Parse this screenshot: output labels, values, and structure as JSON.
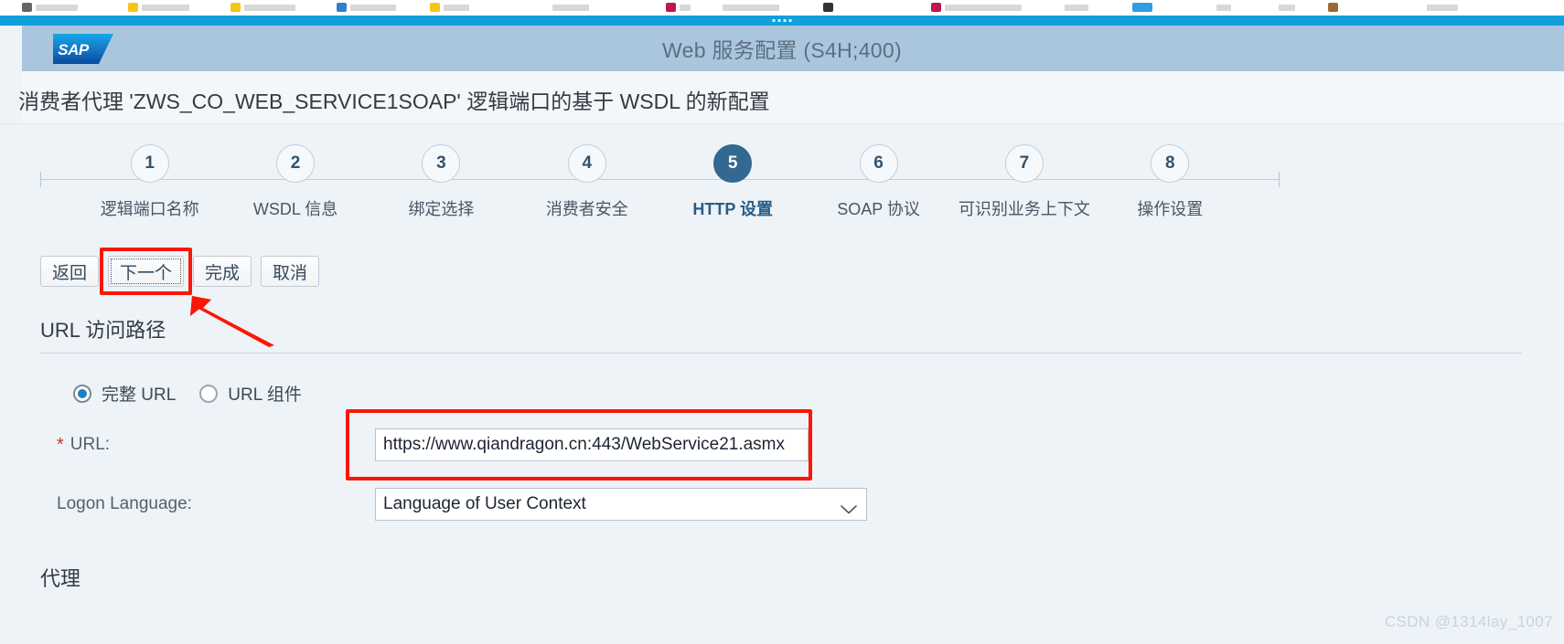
{
  "window": {
    "shell_title": "Web 服务配置 (S4H;400)",
    "logo_text": "SAP",
    "grip_icon": "window-grip-icon"
  },
  "page": {
    "title": "消费者代理 'ZWS_CO_WEB_SERVICE1SOAP' 逻辑端口的基于 WSDL 的新配置"
  },
  "roadmap": {
    "active_index": 5,
    "steps": [
      {
        "number": "1",
        "label": "逻辑端口名称"
      },
      {
        "number": "2",
        "label": "WSDL 信息"
      },
      {
        "number": "3",
        "label": "绑定选择"
      },
      {
        "number": "4",
        "label": "消费者安全"
      },
      {
        "number": "5",
        "label": "HTTP 设置"
      },
      {
        "number": "6",
        "label": "SOAP 协议"
      },
      {
        "number": "7",
        "label": "可识别业务上下文"
      },
      {
        "number": "8",
        "label": "操作设置"
      }
    ]
  },
  "toolbar": {
    "back_label": "返回",
    "next_label": "下一个",
    "finish_label": "完成",
    "cancel_label": "取消"
  },
  "annotations": {
    "highlight_color": "#fc1605",
    "next_button_box": "red-highlight-box",
    "next_button_arrow": "red-arrow-icon",
    "url_field_box": "red-highlight-box"
  },
  "url_section": {
    "title": "URL 访问路径",
    "radios": [
      {
        "label": "完整 URL",
        "checked": true
      },
      {
        "label": "URL 组件",
        "checked": false
      }
    ],
    "url": {
      "required_marker": "*",
      "label": "URL:",
      "value": "https://www.qiandragon.cn:443/WebService21.asmx"
    },
    "logon_language": {
      "label": "Logon Language:",
      "value": "Language of User Context",
      "chevron_icon": "chevron-down-icon"
    }
  },
  "proxy_section": {
    "title": "代理"
  },
  "watermark": {
    "text": "CSDN @1314lay_1007"
  },
  "colors": {
    "accent_blue": "#336891",
    "shell_header": "#aac6de",
    "window_bar": "#11a0dc",
    "page_background": "#eef3f8",
    "annotation_red": "#fc1605"
  }
}
